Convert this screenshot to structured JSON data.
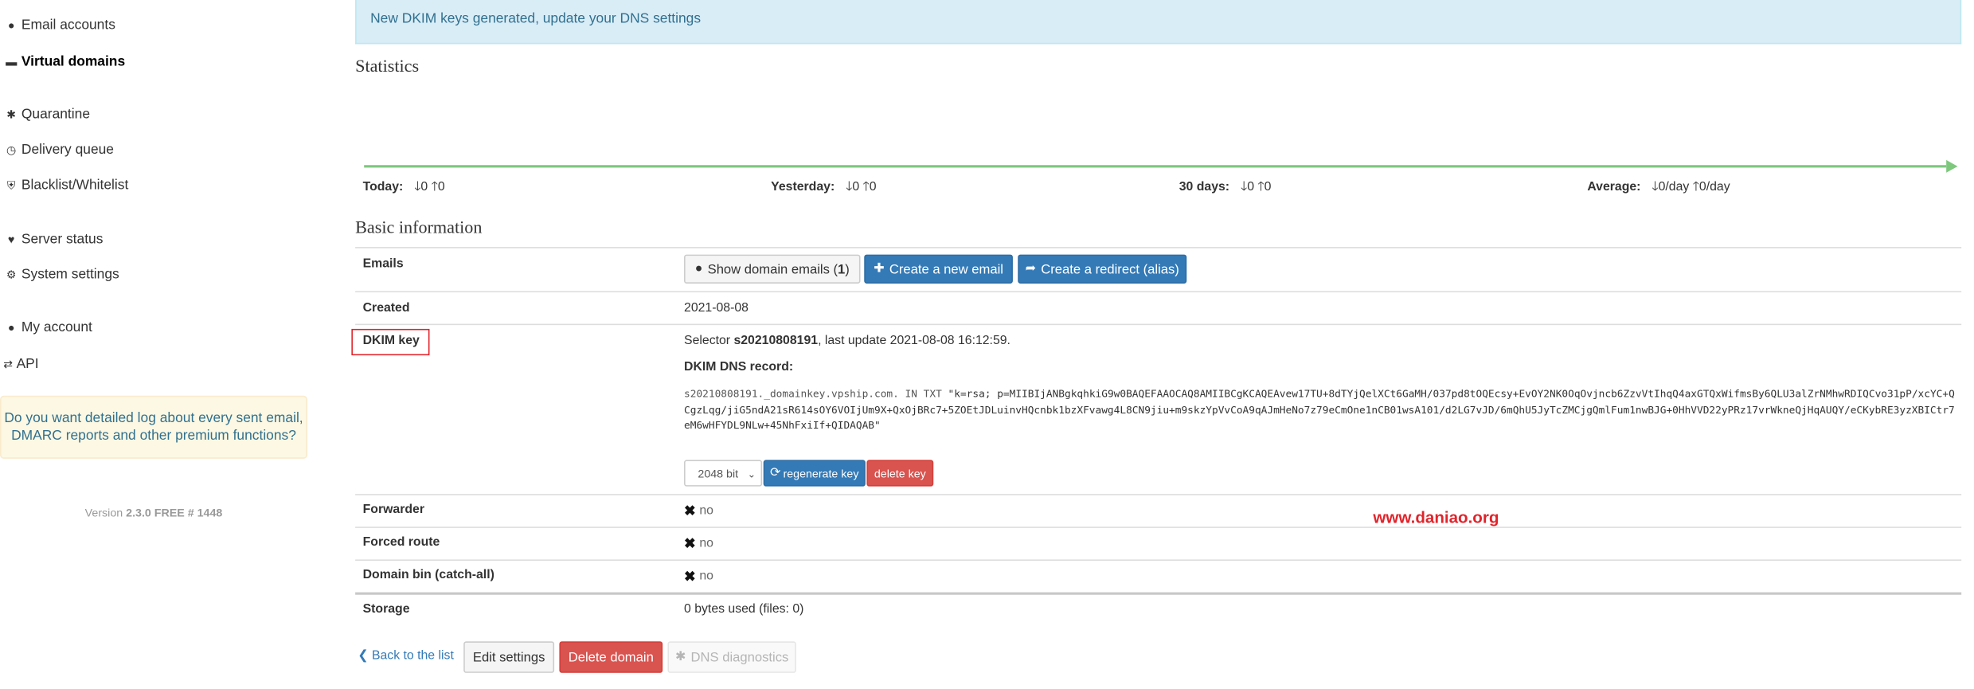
{
  "sidebar": {
    "items": [
      {
        "label": "Email accounts",
        "icon": "users-icon"
      },
      {
        "label": "Virtual domains",
        "icon": "database-icon"
      },
      {
        "label": "Quarantine",
        "icon": "bug-icon"
      },
      {
        "label": "Delivery queue",
        "icon": "clock-icon"
      },
      {
        "label": "Blacklist/Whitelist",
        "icon": "shield-icon"
      },
      {
        "label": "Server status",
        "icon": "heartbeat-icon"
      },
      {
        "label": "System settings",
        "icon": "cogs-icon"
      },
      {
        "label": "My account",
        "icon": "user-icon"
      },
      {
        "label": "API",
        "icon": "exchange-icon"
      }
    ],
    "promo": "Do you want detailed log about every sent email, DMARC reports and other premium functions?",
    "version_prefix": "Version",
    "version_value": "2.3.0 FREE # 1448"
  },
  "alert": "New DKIM keys generated, update your DNS settings",
  "statistics": {
    "title": "Statistics",
    "today_label": "Today:",
    "today_in": "0",
    "today_out": "0",
    "yesterday_label": "Yesterday:",
    "yesterday_in": "0",
    "yesterday_out": "0",
    "days30_label": "30 days:",
    "days30_in": "0",
    "days30_out": "0",
    "average_label": "Average:",
    "average_in": "0/day",
    "average_out": "0/day"
  },
  "basic": {
    "title": "Basic information",
    "emails_label": "Emails",
    "show_emails_btn": "Show domain emails (",
    "show_emails_count": "1",
    "show_emails_close": ")",
    "create_email_btn": "Create a new email",
    "create_redirect_btn": "Create a redirect (alias)",
    "created_label": "Created",
    "created_value": "2021-08-08",
    "dkim_label": "DKIM key",
    "selector_prefix": "Selector",
    "selector_value": "s20210808191",
    "selector_suffix": ", last update 2021-08-08 16:12:59.",
    "dns_record_label": "DKIM DNS record:",
    "dns_record_prefix": "s20210808191._domainkey.vpship.com. IN TXT ",
    "dns_record_value": "\"k=rsa; p=MIIBIjANBgkqhkiG9w0BAQEFAAOCAQ8AMIIBCgKCAQEAvew17TU+8dTYjQelXCt6GaMH/037pd8tOQEcsy+EvOY2NK0OqOvjncb6ZzvVtIhqQ4axGTQxWifmsBy6QLU3alZrNMhwRDIQCvo31pP/xcYC+QCgzLqg/jiG5ndA21sR614sOY6VOIjUm9X+QxOjBRc7+5ZOEtJDLuinvHQcnbk1bzXFvawg4L8CN9jiu+m9skzYpVvCoA9qAJmHeNo7z79eCmOne1nCB01wsA101/d2LG7vJD/6mQhU5JyTcZMCjgQmlFum1nwBJG+0HhVVD22yPRz17vrWkneQjHqAUQY/eCKybRE3yzXBICtr7eM6wHFYDL9NLw+45NhFxiIf+QIDAQAB\"",
    "key_size": "2048 bit",
    "regenerate_btn": "regenerate key",
    "delete_key_btn": "delete key",
    "forwarder_label": "Forwarder",
    "forwarder_value": "no",
    "forced_route_label": "Forced route",
    "forced_route_value": "no",
    "domain_bin_label": "Domain bin (catch-all)",
    "domain_bin_value": "no",
    "storage_label": "Storage",
    "storage_value": "0 bytes used (files: 0)"
  },
  "watermark": "www.daniao.org",
  "footer": {
    "back_link": "Back to the list",
    "edit_btn": "Edit settings",
    "delete_btn": "Delete domain",
    "dns_diag_btn": "DNS diagnostics"
  },
  "colors": {
    "primary": "#337ab7",
    "danger": "#d9534f",
    "stat_line": "#7dc87d",
    "alert_bg": "#d9edf7",
    "highlight": "#e2232a"
  }
}
